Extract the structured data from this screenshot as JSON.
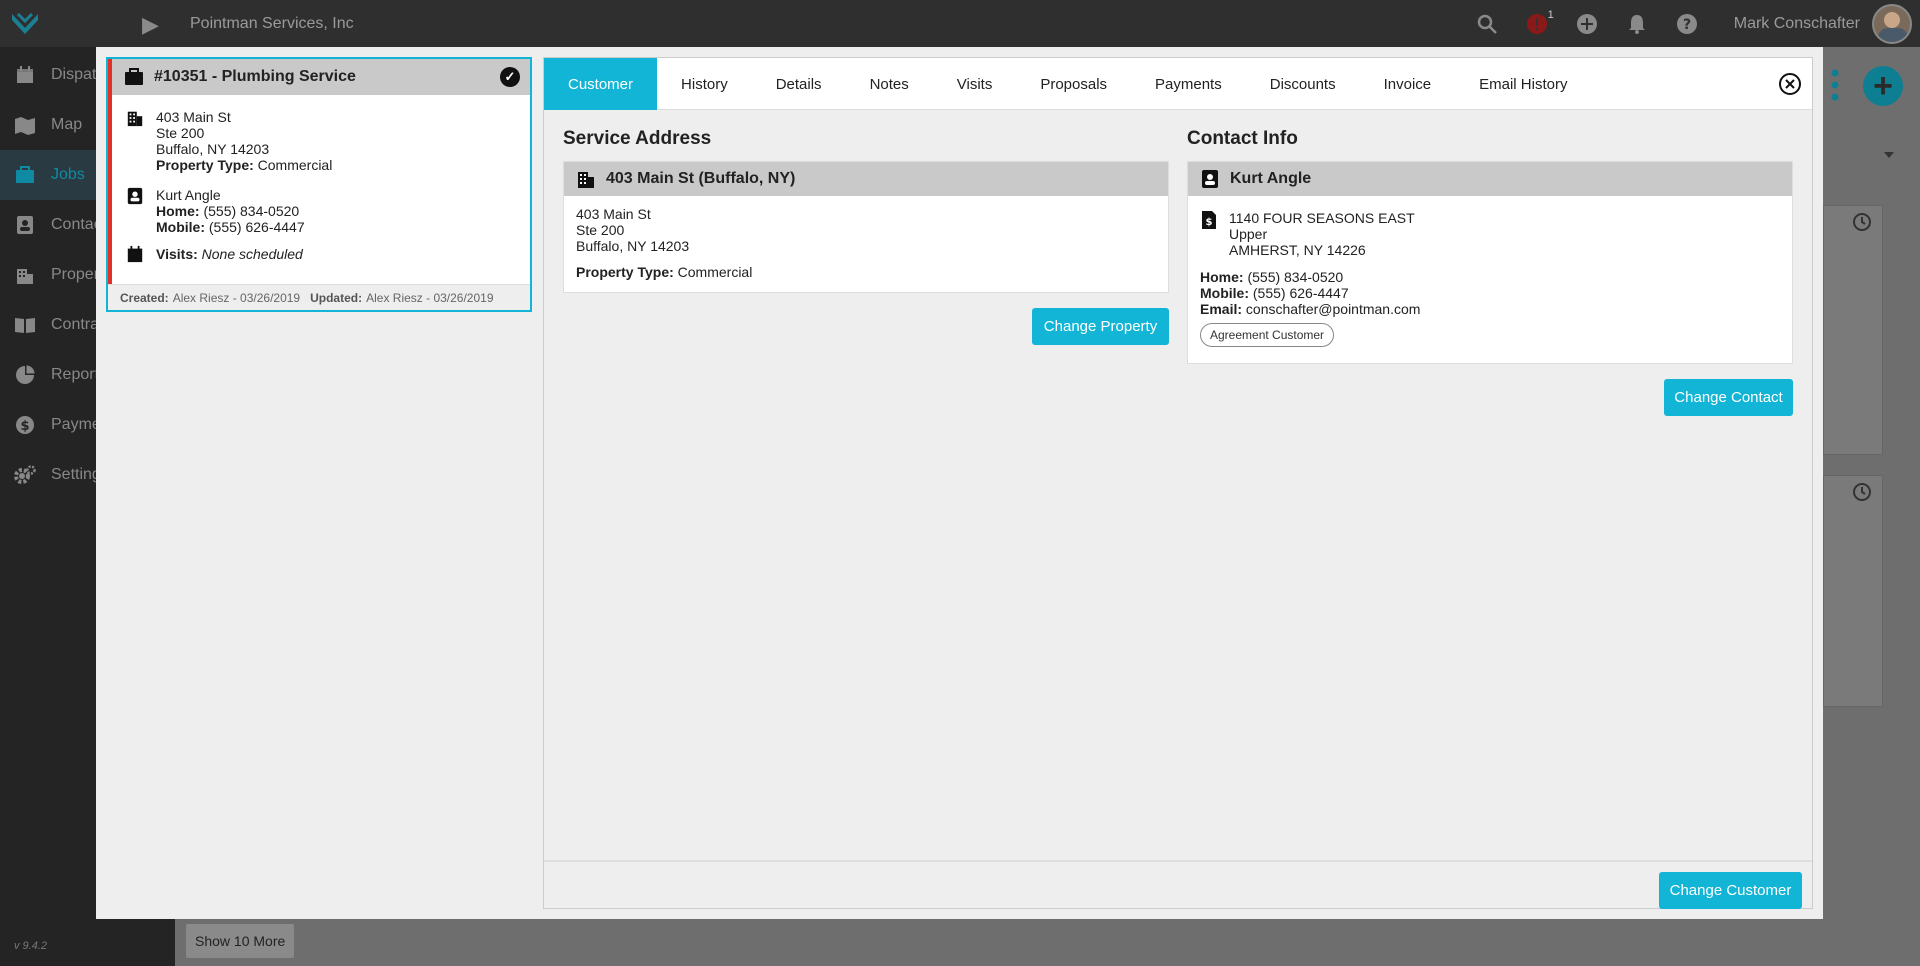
{
  "app": {
    "company": "Pointman Services, Inc",
    "username": "Mark Conschafter",
    "alert_count": "1",
    "version": "v 9.4.2"
  },
  "nav": {
    "items": [
      {
        "label": "Dispat",
        "icon": "calendar-icon"
      },
      {
        "label": "Map",
        "icon": "map-icon"
      },
      {
        "label": "Jobs",
        "icon": "briefcase-icon"
      },
      {
        "label": "Contac",
        "icon": "contact-card-icon"
      },
      {
        "label": "Proper",
        "icon": "building-icon"
      },
      {
        "label": "Contra",
        "icon": "book-icon"
      },
      {
        "label": "Report",
        "icon": "pie-chart-icon"
      },
      {
        "label": "Payme",
        "icon": "dollar-icon"
      },
      {
        "label": "Setting",
        "icon": "gear-icon"
      }
    ]
  },
  "background": {
    "show_more": "Show 10 More"
  },
  "job": {
    "title": "#10351 - Plumbing Service",
    "address_line1": "403 Main St",
    "address_line2": "Ste 200",
    "address_line3": "Buffalo, NY 14203",
    "property_type_label": "Property Type:",
    "property_type": "Commercial",
    "contact_name": "Kurt Angle",
    "home_label": "Home:",
    "home_phone": "(555) 834-0520",
    "mobile_label": "Mobile:",
    "mobile_phone": "(555) 626-4447",
    "visits_label": "Visits:",
    "visits_value": "None scheduled",
    "created_label": "Created:",
    "created_value": "Alex Riesz - 03/26/2019",
    "updated_label": "Updated:",
    "updated_value": "Alex Riesz - 03/26/2019"
  },
  "tabs": [
    "Customer",
    "History",
    "Details",
    "Notes",
    "Visits",
    "Proposals",
    "Payments",
    "Discounts",
    "Invoice",
    "Email History"
  ],
  "active_tab": "Customer",
  "service_address": {
    "section_title": "Service Address",
    "card_title": "403 Main St (Buffalo, NY)",
    "line1": "403 Main St",
    "line2": "Ste 200",
    "line3": "Buffalo, NY 14203",
    "property_type_label": "Property Type:",
    "property_type": "Commercial",
    "button": "Change Property"
  },
  "contact_info": {
    "section_title": "Contact Info",
    "card_title": "Kurt Angle",
    "billing_line1": "1140 FOUR SEASONS EAST",
    "billing_line2": "Upper",
    "billing_line3": "AMHERST, NY 14226",
    "home_label": "Home:",
    "home_phone": "(555) 834-0520",
    "mobile_label": "Mobile:",
    "mobile_phone": "(555) 626-4447",
    "email_label": "Email:",
    "email": "conschafter@pointman.com",
    "tag": "Agreement Customer",
    "button": "Change Contact"
  },
  "footer": {
    "button": "Change Customer"
  },
  "colors": {
    "accent": "#13b5d6",
    "status_bar": "#e0322a",
    "nav_active": "#0e8aa3"
  }
}
